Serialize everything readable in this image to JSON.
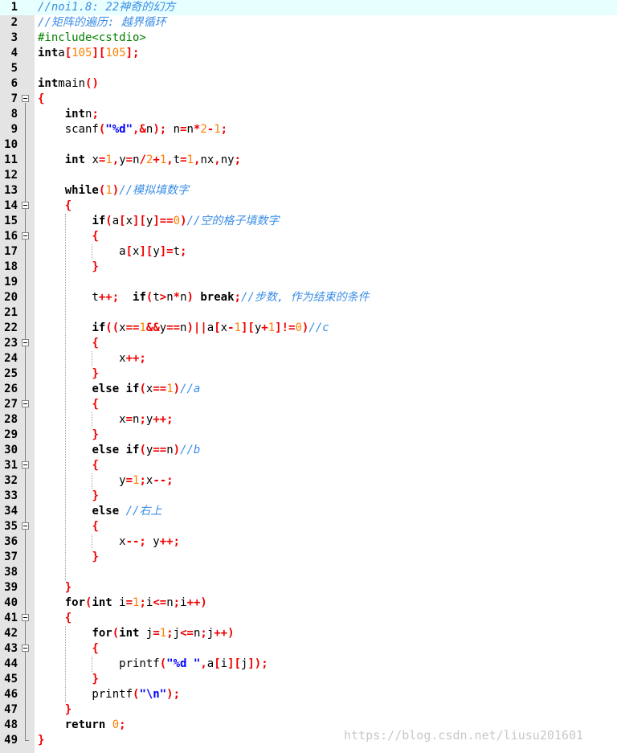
{
  "lines": [
    {
      "n": "1",
      "tokens": [
        [
          "cm",
          "//noi1.8: 22神奇的幻方"
        ]
      ]
    },
    {
      "n": "2",
      "tokens": [
        [
          "cm",
          "//矩阵的遍历: 越界循环"
        ]
      ]
    },
    {
      "n": "3",
      "tokens": [
        [
          "pp",
          "#include<cstdio>"
        ]
      ]
    },
    {
      "n": "4",
      "tokens": [
        [
          "kw",
          "int"
        ],
        [
          "",
          "a"
        ],
        [
          "op",
          "["
        ],
        [
          "num",
          "105"
        ],
        [
          "op",
          "]["
        ],
        [
          "num",
          "105"
        ],
        [
          "op",
          "];"
        ]
      ]
    },
    {
      "n": "5",
      "tokens": []
    },
    {
      "n": "6",
      "tokens": [
        [
          "kw",
          "int"
        ],
        [
          "",
          "main"
        ],
        [
          "op",
          "()"
        ]
      ]
    },
    {
      "n": "7",
      "tokens": [
        [
          "op",
          "{"
        ]
      ]
    },
    {
      "n": "8",
      "tokens": [
        [
          "",
          "    "
        ],
        [
          "kw",
          "int"
        ],
        [
          "",
          "n"
        ],
        [
          "op",
          ";"
        ]
      ]
    },
    {
      "n": "9",
      "tokens": [
        [
          "",
          "    scanf"
        ],
        [
          "op",
          "("
        ],
        [
          "str",
          "\"%d\""
        ],
        [
          "op",
          ",&"
        ],
        [
          "",
          "n"
        ],
        [
          "op",
          ");"
        ],
        [
          "",
          " n"
        ],
        [
          "op",
          "="
        ],
        [
          "",
          "n"
        ],
        [
          "op",
          "*"
        ],
        [
          "num",
          "2"
        ],
        [
          "op",
          "-"
        ],
        [
          "num",
          "1"
        ],
        [
          "op",
          ";"
        ]
      ]
    },
    {
      "n": "10",
      "tokens": []
    },
    {
      "n": "11",
      "tokens": [
        [
          "",
          "    "
        ],
        [
          "kw",
          "int"
        ],
        [
          "",
          " x"
        ],
        [
          "op",
          "="
        ],
        [
          "num",
          "1"
        ],
        [
          "op",
          ","
        ],
        [
          "",
          "y"
        ],
        [
          "op",
          "="
        ],
        [
          "",
          "n"
        ],
        [
          "op",
          "/"
        ],
        [
          "num",
          "2"
        ],
        [
          "op",
          "+"
        ],
        [
          "num",
          "1"
        ],
        [
          "op",
          ","
        ],
        [
          "",
          "t"
        ],
        [
          "op",
          "="
        ],
        [
          "num",
          "1"
        ],
        [
          "op",
          ","
        ],
        [
          "",
          "nx"
        ],
        [
          "op",
          ","
        ],
        [
          "",
          "ny"
        ],
        [
          "op",
          ";"
        ]
      ]
    },
    {
      "n": "12",
      "tokens": []
    },
    {
      "n": "13",
      "tokens": [
        [
          "",
          "    "
        ],
        [
          "kw",
          "while"
        ],
        [
          "op",
          "("
        ],
        [
          "num",
          "1"
        ],
        [
          "op",
          ")"
        ],
        [
          "cm",
          "//模拟填数字"
        ]
      ]
    },
    {
      "n": "14",
      "tokens": [
        [
          "",
          "    "
        ],
        [
          "op",
          "{"
        ]
      ]
    },
    {
      "n": "15",
      "tokens": [
        [
          "",
          "        "
        ],
        [
          "kw",
          "if"
        ],
        [
          "op",
          "("
        ],
        [
          "",
          "a"
        ],
        [
          "op",
          "["
        ],
        [
          "",
          "x"
        ],
        [
          "op",
          "]["
        ],
        [
          "",
          "y"
        ],
        [
          "op",
          "]=="
        ],
        [
          "num",
          "0"
        ],
        [
          "op",
          ")"
        ],
        [
          "cm",
          "//空的格子填数字"
        ]
      ]
    },
    {
      "n": "16",
      "tokens": [
        [
          "",
          "        "
        ],
        [
          "op",
          "{"
        ]
      ]
    },
    {
      "n": "17",
      "tokens": [
        [
          "",
          "            a"
        ],
        [
          "op",
          "["
        ],
        [
          "",
          "x"
        ],
        [
          "op",
          "]["
        ],
        [
          "",
          "y"
        ],
        [
          "op",
          "]="
        ],
        [
          "",
          "t"
        ],
        [
          "op",
          ";"
        ]
      ]
    },
    {
      "n": "18",
      "tokens": [
        [
          "",
          "        "
        ],
        [
          "op",
          "}"
        ]
      ]
    },
    {
      "n": "19",
      "tokens": []
    },
    {
      "n": "20",
      "tokens": [
        [
          "",
          "        t"
        ],
        [
          "op",
          "++;"
        ],
        [
          "",
          "  "
        ],
        [
          "kw",
          "if"
        ],
        [
          "op",
          "("
        ],
        [
          "",
          "t"
        ],
        [
          "op",
          ">"
        ],
        [
          "",
          "n"
        ],
        [
          "op",
          "*"
        ],
        [
          "",
          "n"
        ],
        [
          "op",
          ")"
        ],
        [
          "",
          " "
        ],
        [
          "kw",
          "break"
        ],
        [
          "op",
          ";"
        ],
        [
          "cm",
          "//步数, 作为结束的条件"
        ]
      ]
    },
    {
      "n": "21",
      "tokens": []
    },
    {
      "n": "22",
      "tokens": [
        [
          "",
          "        "
        ],
        [
          "kw",
          "if"
        ],
        [
          "op",
          "(("
        ],
        [
          "",
          "x"
        ],
        [
          "op",
          "=="
        ],
        [
          "num",
          "1"
        ],
        [
          "op",
          "&&"
        ],
        [
          "",
          "y"
        ],
        [
          "op",
          "=="
        ],
        [
          "",
          "n"
        ],
        [
          "op",
          ")||"
        ],
        [
          "",
          "a"
        ],
        [
          "op",
          "["
        ],
        [
          "",
          "x"
        ],
        [
          "op",
          "-"
        ],
        [
          "num",
          "1"
        ],
        [
          "op",
          "]["
        ],
        [
          "",
          "y"
        ],
        [
          "op",
          "+"
        ],
        [
          "num",
          "1"
        ],
        [
          "op",
          "]!="
        ],
        [
          "num",
          "0"
        ],
        [
          "op",
          ")"
        ],
        [
          "cm",
          "//c"
        ]
      ]
    },
    {
      "n": "23",
      "tokens": [
        [
          "",
          "        "
        ],
        [
          "op",
          "{"
        ]
      ]
    },
    {
      "n": "24",
      "tokens": [
        [
          "",
          "            x"
        ],
        [
          "op",
          "++;"
        ]
      ]
    },
    {
      "n": "25",
      "tokens": [
        [
          "",
          "        "
        ],
        [
          "op",
          "}"
        ]
      ]
    },
    {
      "n": "26",
      "tokens": [
        [
          "",
          "        "
        ],
        [
          "kw",
          "else if"
        ],
        [
          "op",
          "("
        ],
        [
          "",
          "x"
        ],
        [
          "op",
          "=="
        ],
        [
          "num",
          "1"
        ],
        [
          "op",
          ")"
        ],
        [
          "cm",
          "//a"
        ]
      ]
    },
    {
      "n": "27",
      "tokens": [
        [
          "",
          "        "
        ],
        [
          "op",
          "{"
        ]
      ]
    },
    {
      "n": "28",
      "tokens": [
        [
          "",
          "            x"
        ],
        [
          "op",
          "="
        ],
        [
          "",
          "n"
        ],
        [
          "op",
          ";"
        ],
        [
          "",
          "y"
        ],
        [
          "op",
          "++;"
        ]
      ]
    },
    {
      "n": "29",
      "tokens": [
        [
          "",
          "        "
        ],
        [
          "op",
          "}"
        ]
      ]
    },
    {
      "n": "30",
      "tokens": [
        [
          "",
          "        "
        ],
        [
          "kw",
          "else if"
        ],
        [
          "op",
          "("
        ],
        [
          "",
          "y"
        ],
        [
          "op",
          "=="
        ],
        [
          "",
          "n"
        ],
        [
          "op",
          ")"
        ],
        [
          "cm",
          "//b"
        ]
      ]
    },
    {
      "n": "31",
      "tokens": [
        [
          "",
          "        "
        ],
        [
          "op",
          "{"
        ]
      ]
    },
    {
      "n": "32",
      "tokens": [
        [
          "",
          "            y"
        ],
        [
          "op",
          "="
        ],
        [
          "num",
          "1"
        ],
        [
          "op",
          ";"
        ],
        [
          "",
          "x"
        ],
        [
          "op",
          "--;"
        ]
      ]
    },
    {
      "n": "33",
      "tokens": [
        [
          "",
          "        "
        ],
        [
          "op",
          "}"
        ]
      ]
    },
    {
      "n": "34",
      "tokens": [
        [
          "",
          "        "
        ],
        [
          "kw",
          "else"
        ],
        [
          "",
          " "
        ],
        [
          "cm",
          "//右上"
        ]
      ]
    },
    {
      "n": "35",
      "tokens": [
        [
          "",
          "        "
        ],
        [
          "op",
          "{"
        ]
      ]
    },
    {
      "n": "36",
      "tokens": [
        [
          "",
          "            x"
        ],
        [
          "op",
          "--;"
        ],
        [
          "",
          " y"
        ],
        [
          "op",
          "++;"
        ]
      ]
    },
    {
      "n": "37",
      "tokens": [
        [
          "",
          "        "
        ],
        [
          "op",
          "}"
        ]
      ]
    },
    {
      "n": "38",
      "tokens": []
    },
    {
      "n": "39",
      "tokens": [
        [
          "",
          "    "
        ],
        [
          "op",
          "}"
        ]
      ]
    },
    {
      "n": "40",
      "tokens": [
        [
          "",
          "    "
        ],
        [
          "kw",
          "for"
        ],
        [
          "op",
          "("
        ],
        [
          "kw",
          "int"
        ],
        [
          "",
          " i"
        ],
        [
          "op",
          "="
        ],
        [
          "num",
          "1"
        ],
        [
          "op",
          ";"
        ],
        [
          "",
          "i"
        ],
        [
          "op",
          "<="
        ],
        [
          "",
          "n"
        ],
        [
          "op",
          ";"
        ],
        [
          "",
          "i"
        ],
        [
          "op",
          "++)"
        ]
      ]
    },
    {
      "n": "41",
      "tokens": [
        [
          "",
          "    "
        ],
        [
          "op",
          "{"
        ]
      ]
    },
    {
      "n": "42",
      "tokens": [
        [
          "",
          "        "
        ],
        [
          "kw",
          "for"
        ],
        [
          "op",
          "("
        ],
        [
          "kw",
          "int"
        ],
        [
          "",
          " j"
        ],
        [
          "op",
          "="
        ],
        [
          "num",
          "1"
        ],
        [
          "op",
          ";"
        ],
        [
          "",
          "j"
        ],
        [
          "op",
          "<="
        ],
        [
          "",
          "n"
        ],
        [
          "op",
          ";"
        ],
        [
          "",
          "j"
        ],
        [
          "op",
          "++)"
        ]
      ]
    },
    {
      "n": "43",
      "tokens": [
        [
          "",
          "        "
        ],
        [
          "op",
          "{"
        ]
      ]
    },
    {
      "n": "44",
      "tokens": [
        [
          "",
          "            printf"
        ],
        [
          "op",
          "("
        ],
        [
          "str",
          "\"%d \""
        ],
        [
          "op",
          ","
        ],
        [
          "",
          "a"
        ],
        [
          "op",
          "["
        ],
        [
          "",
          "i"
        ],
        [
          "op",
          "]["
        ],
        [
          "",
          "j"
        ],
        [
          "op",
          "]);"
        ]
      ]
    },
    {
      "n": "45",
      "tokens": [
        [
          "",
          "        "
        ],
        [
          "op",
          "}"
        ]
      ]
    },
    {
      "n": "46",
      "tokens": [
        [
          "",
          "        printf"
        ],
        [
          "op",
          "("
        ],
        [
          "str",
          "\"\\n\""
        ],
        [
          "op",
          ");"
        ]
      ]
    },
    {
      "n": "47",
      "tokens": [
        [
          "",
          "    "
        ],
        [
          "op",
          "}"
        ]
      ]
    },
    {
      "n": "48",
      "tokens": [
        [
          "",
          "    "
        ],
        [
          "kw",
          "return"
        ],
        [
          "",
          " "
        ],
        [
          "num",
          "0"
        ],
        [
          "op",
          ";"
        ]
      ]
    },
    {
      "n": "49",
      "tokens": [
        [
          "op",
          "}"
        ]
      ]
    }
  ],
  "folds": [
    7,
    14,
    16,
    23,
    27,
    31,
    35,
    41,
    43
  ],
  "watermark": "https://blog.csdn.net/liusu201601",
  "colors": {
    "comment": "#3b8ee6",
    "operator": "#ee0000",
    "number": "#ff7f00",
    "string": "#0000ff",
    "preprocessor": "#008000",
    "current_line": "#e8ffff",
    "gutter": "#e4e4e4"
  }
}
